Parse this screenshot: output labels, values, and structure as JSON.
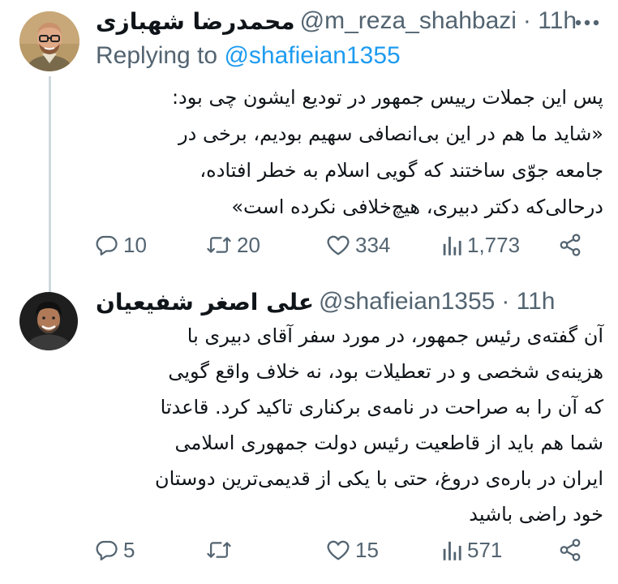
{
  "colors": {
    "text": "#0f1419",
    "secondary": "#536471",
    "accent": "#1d9bf0",
    "thread_line": "#cfd9de"
  },
  "tweets": [
    {
      "display_name": "محمدرضا شهبازی",
      "handle": "@m_reza_shahbazi",
      "time": "· 11h",
      "replying_prefix": "Replying to",
      "replying_to": "@shafieian1355",
      "lines": [
        "پس این جملات رییس جمهور در تودیع ایشون چی بود:",
        "«شاید ما هم در این بی‌انصافی سهیم بودیم، برخی در",
        "جامعه جوّی ساختند که گویی اسلام به خطر افتاده،",
        "درحالی‌که دکتر دبیری، هیچ‌خلافی نکرده است»"
      ],
      "stats": {
        "replies": "10",
        "retweets": "20",
        "likes": "334",
        "views": "1,773"
      }
    },
    {
      "display_name": "علی اصغر شفیعیان",
      "handle": "@shafieian1355",
      "time": "· 11h",
      "lines": [
        "آن گفته‌ی رئیس جمهور، در مورد سفر آقای دبیری با",
        "هزینه‌ی شخصی و در تعطیلات بود، نه خلاف واقع گویی",
        "که آن را به صراحت در نامه‌ی برکناری تاکید کرد. قاعدتا",
        "شما هم باید از قاطعیت رئیس دولت جمهوری اسلامی",
        "ایران در باره‌ی دروغ، حتی با یکی از قدیمی‌ترین دوستان",
        "خود راضی باشید"
      ],
      "stats": {
        "replies": "5",
        "retweets": "",
        "likes": "15",
        "views": "571"
      }
    }
  ],
  "icons": {
    "more": "more-dots-icon",
    "reply": "reply-bubble-icon",
    "retweet": "retweet-arrows-icon",
    "like": "heart-icon",
    "views": "views-bars-icon",
    "share": "share-nodes-icon"
  }
}
